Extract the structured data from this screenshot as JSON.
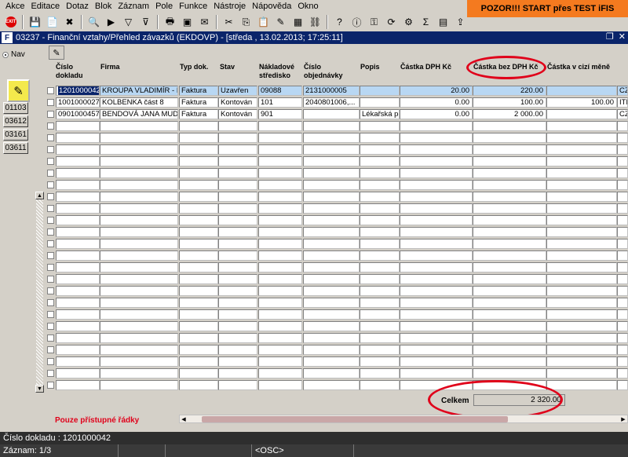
{
  "menu": [
    "Akce",
    "Editace",
    "Dotaz",
    "Blok",
    "Záznam",
    "Pole",
    "Funkce",
    "Nástroje",
    "Nápověda",
    "Okno"
  ],
  "banner": "POZOR!!!  START přes TEST iFIS",
  "window_title": "03237 - Finanční vztahy/Přehled závazků (EKDOVP) - [středa , 13.02.2013; 17:25:11]",
  "nav": {
    "radio_label": "Nav",
    "buttons": [
      "01103",
      "03612",
      "03161",
      "03611"
    ]
  },
  "columns": {
    "cislo_dokladu": "Číslo dokladu",
    "firma": "Firma",
    "typ_dok": "Typ dok.",
    "stav": "Stav",
    "nakladove_stredisko": "Nákladové středisko",
    "cislo_objednavky": "Číslo objednávky",
    "popis": "Popis",
    "castka_dph": "Částka DPH Kč",
    "castka_bez_dph": "Částka bez DPH Kč",
    "castka_cizi": "Částka v cizí měně"
  },
  "rows": [
    {
      "doklad": "1201000042",
      "firma": "KROUPA VLADIMÍR - R",
      "typ": "Faktura",
      "stav": "Uzavřen",
      "stredisko": "09088",
      "objednavka": "2131000005",
      "popis": "",
      "dph": "20.00",
      "bez_dph": "220.00",
      "cizi": "",
      "mena": "CZ"
    },
    {
      "doklad": "1001000027",
      "firma": "KOLBENKA část 8",
      "typ": "Faktura",
      "stav": "Kontován",
      "stredisko": "101",
      "objednavka": "2040801006,...",
      "popis": "",
      "dph": "0.00",
      "bez_dph": "100.00",
      "cizi": "100.00",
      "mena": "ITL"
    },
    {
      "doklad": "0901000457",
      "firma": "BENDOVÁ JANA MUDR. I",
      "typ": "Faktura",
      "stav": "Kontován",
      "stredisko": "901",
      "objednavka": "",
      "popis": "Lékařská pé",
      "dph": "0.00",
      "bez_dph": "2 000.00",
      "cizi": "",
      "mena": "CZ"
    }
  ],
  "total": {
    "label": "Celkem",
    "value": "2 320.00"
  },
  "only_rows_label": "Pouze přístupné řádky",
  "status": {
    "field": "Číslo dokladu : 1201000042",
    "record": "Záznam: 1/3",
    "mode": "<OSC>"
  },
  "colors": {
    "title_bar": "#0a246a",
    "banner": "#f47a1f",
    "highlight": "#e0001a",
    "selected_row": "#b8d7f3"
  }
}
